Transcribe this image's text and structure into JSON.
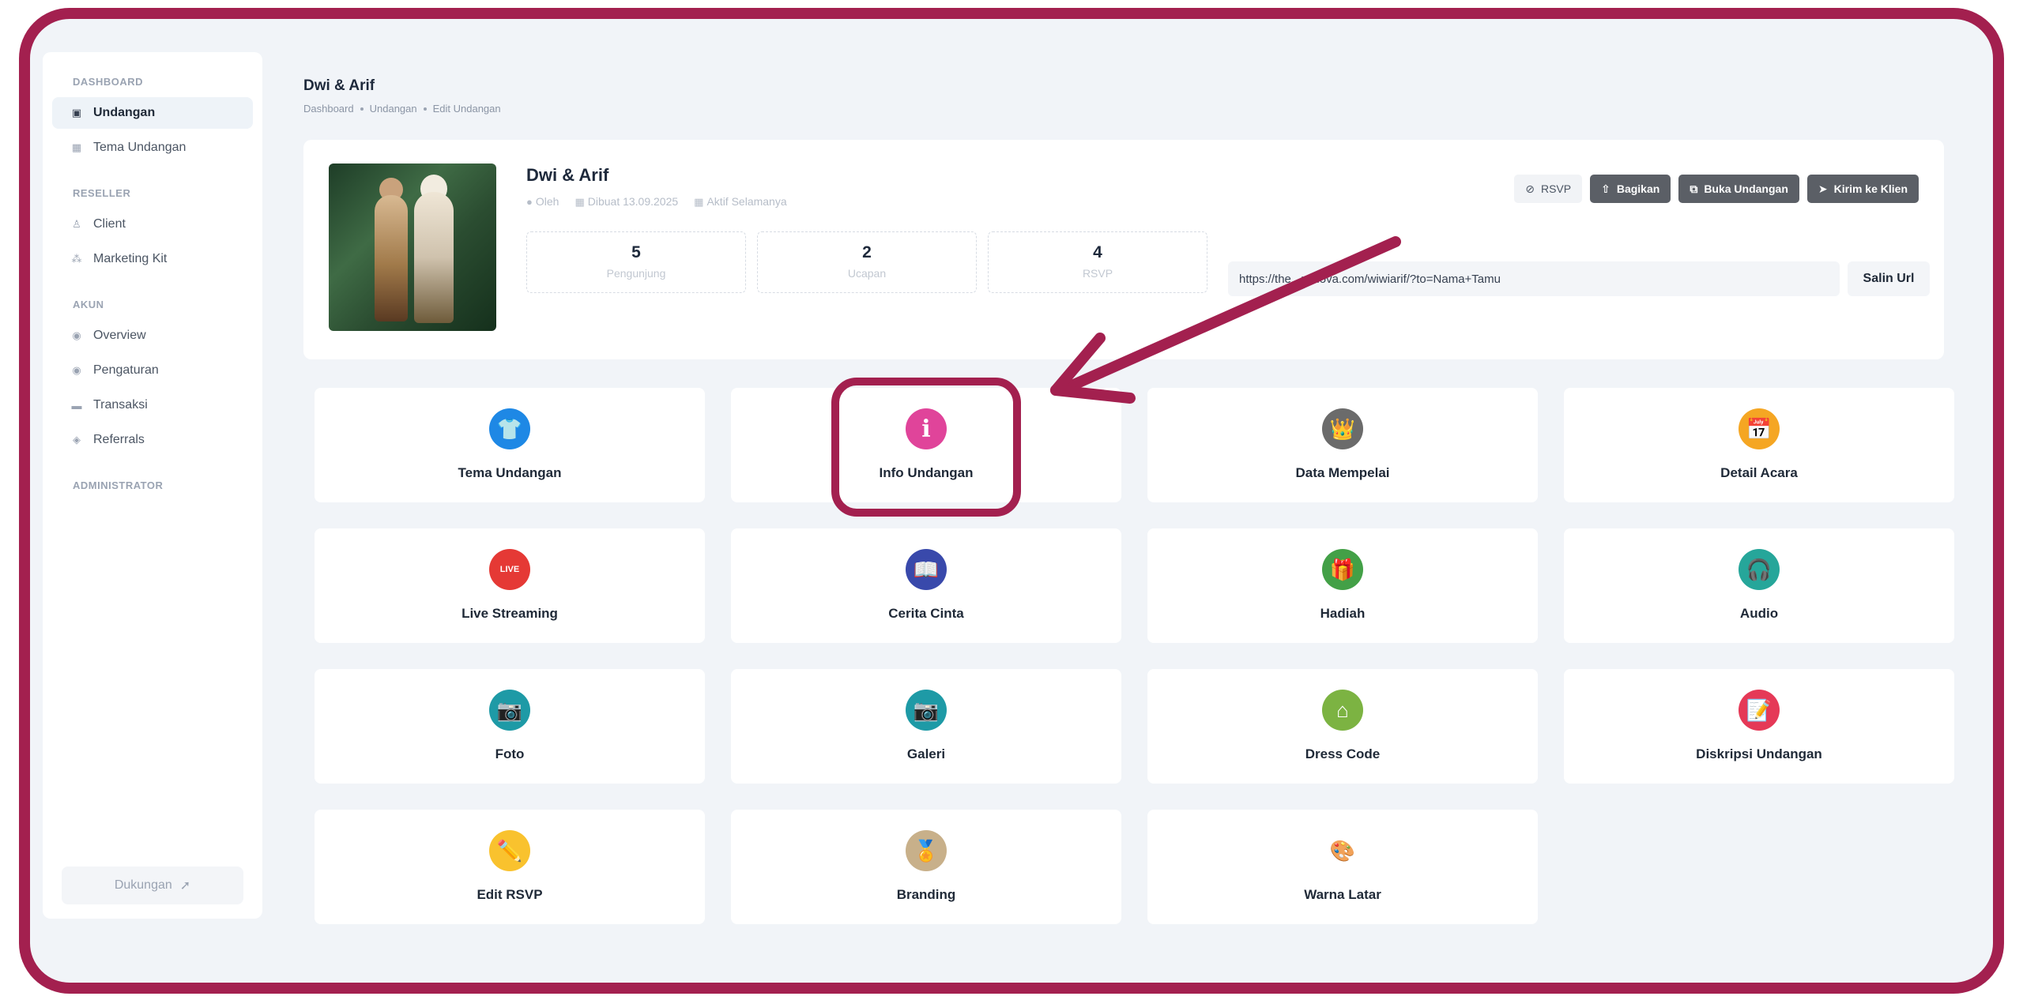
{
  "sidebar": {
    "sections": [
      {
        "title": "DASHBOARD",
        "items": [
          {
            "label": "Undangan",
            "icon": "invitation-icon",
            "active": true
          },
          {
            "label": "Tema Undangan",
            "icon": "theme-icon",
            "active": false
          }
        ]
      },
      {
        "title": "RESELLER",
        "items": [
          {
            "label": "Client",
            "icon": "client-icon",
            "active": false
          },
          {
            "label": "Marketing Kit",
            "icon": "marketing-icon",
            "active": false
          }
        ]
      },
      {
        "title": "AKUN",
        "items": [
          {
            "label": "Overview",
            "icon": "overview-icon",
            "active": false
          },
          {
            "label": "Pengaturan",
            "icon": "settings-icon",
            "active": false
          },
          {
            "label": "Transaksi",
            "icon": "transaction-icon",
            "active": false
          },
          {
            "label": "Referrals",
            "icon": "referral-icon",
            "active": false
          }
        ]
      },
      {
        "title": "ADMINISTRATOR",
        "items": []
      }
    ],
    "support_label": "Dukungan"
  },
  "header": {
    "title": "Dwi & Arif",
    "breadcrumb": [
      "Dashboard",
      "Undangan",
      "Edit Undangan"
    ]
  },
  "invitation": {
    "name": "Dwi & Arif",
    "meta": {
      "by": "Oleh",
      "created": "Dibuat 13.09.2025",
      "status": "Aktif Selamanya"
    },
    "stats": [
      {
        "value": "5",
        "label": "Pengunjung"
      },
      {
        "value": "2",
        "label": "Ucapan"
      },
      {
        "value": "4",
        "label": "RSVP"
      }
    ],
    "actions": [
      {
        "label": "RSVP",
        "style": "light",
        "icon": "rsvp-icon"
      },
      {
        "label": "Bagikan",
        "style": "dark",
        "icon": "share-icon"
      },
      {
        "label": "Buka Undangan",
        "style": "dark",
        "icon": "open-icon"
      },
      {
        "label": "Kirim ke Klien",
        "style": "dark",
        "icon": "send-icon"
      }
    ],
    "url": "https://the...ndilova.com/wiwiarif/?to=Nama+Tamu",
    "copy_label": "Salin Url"
  },
  "menu": [
    {
      "label": "Tema Undangan",
      "icon": "shirt-icon",
      "color": "#1e88e5",
      "glyph": "👕"
    },
    {
      "label": "Info Undangan",
      "icon": "info-icon",
      "color": "#e0449a",
      "glyph": "i"
    },
    {
      "label": "Data Mempelai",
      "icon": "crowns-icon",
      "color": "#6b6b6b",
      "glyph": "👑"
    },
    {
      "label": "Detail Acara",
      "icon": "calendar-icon",
      "color": "#f5a623",
      "glyph": "📅"
    },
    {
      "label": "Live Streaming",
      "icon": "live-icon",
      "color": "#e53935",
      "glyph": "LIVE"
    },
    {
      "label": "Cerita Cinta",
      "icon": "book-icon",
      "color": "#3949ab",
      "glyph": "📖"
    },
    {
      "label": "Hadiah",
      "icon": "gift-icon",
      "color": "#43a047",
      "glyph": "🎁"
    },
    {
      "label": "Audio",
      "icon": "headphones-icon",
      "color": "#26a69a",
      "glyph": "🎧"
    },
    {
      "label": "Foto",
      "icon": "camera-icon",
      "color": "#1e9aa6",
      "glyph": "📷"
    },
    {
      "label": "Galeri",
      "icon": "gallery-camera-icon",
      "color": "#1e9aa6",
      "glyph": "📷"
    },
    {
      "label": "Dress Code",
      "icon": "hanger-icon",
      "color": "#7cb342",
      "glyph": "⌂"
    },
    {
      "label": "Diskripsi Undangan",
      "icon": "document-icon",
      "color": "#e53957",
      "glyph": "📝"
    },
    {
      "label": "Edit RSVP",
      "icon": "pencil-icon",
      "color": "#f9c22e",
      "glyph": "✏️"
    },
    {
      "label": "Branding",
      "icon": "brand-badge-icon",
      "color": "#c8b08a",
      "glyph": "🏅"
    },
    {
      "label": "Warna Latar",
      "icon": "palette-icon",
      "color": "#ffffff",
      "glyph": "🎨"
    }
  ],
  "colors": {
    "accent_frame": "#a3204f",
    "background": "#f1f4f8",
    "dark_button": "#5b5f66"
  }
}
